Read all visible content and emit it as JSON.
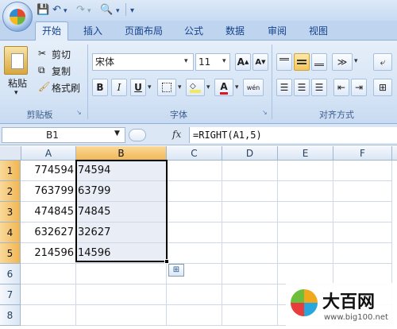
{
  "ribbon_tabs": [
    "开始",
    "插入",
    "页面布局",
    "公式",
    "数据",
    "审阅",
    "视图"
  ],
  "clipboard": {
    "paste": "粘贴",
    "cut": "剪切",
    "copy": "复制",
    "format_painter": "格式刷",
    "group": "剪贴板"
  },
  "font": {
    "name": "宋体",
    "size": "11",
    "bold": "B",
    "italic": "I",
    "underline": "U",
    "grow": "A",
    "shrink": "A",
    "font_color_letter": "A",
    "phonetic": "wén",
    "group": "字体"
  },
  "alignment": {
    "group": "对齐方式"
  },
  "formula_bar": {
    "name_box": "B1",
    "fx": "fx",
    "formula": "=RIGHT(A1,5)"
  },
  "columns": [
    "A",
    "B",
    "C",
    "D",
    "E",
    "F"
  ],
  "rows": [
    {
      "n": "1",
      "a": "774594",
      "b": "74594"
    },
    {
      "n": "2",
      "a": "763799",
      "b": "63799"
    },
    {
      "n": "3",
      "a": "474845",
      "b": "74845"
    },
    {
      "n": "4",
      "a": "632627",
      "b": "32627"
    },
    {
      "n": "5",
      "a": "214596",
      "b": "14596"
    },
    {
      "n": "6",
      "a": "",
      "b": ""
    },
    {
      "n": "7",
      "a": "",
      "b": ""
    },
    {
      "n": "8",
      "a": "",
      "b": ""
    }
  ],
  "watermark": {
    "brand": "大百网",
    "url": "www.big100.net"
  },
  "colors": {
    "accent": "#15428b",
    "ribbon": "#dbe7f6",
    "selection_border": "#000000",
    "selection_fill": "#e8edf6"
  }
}
